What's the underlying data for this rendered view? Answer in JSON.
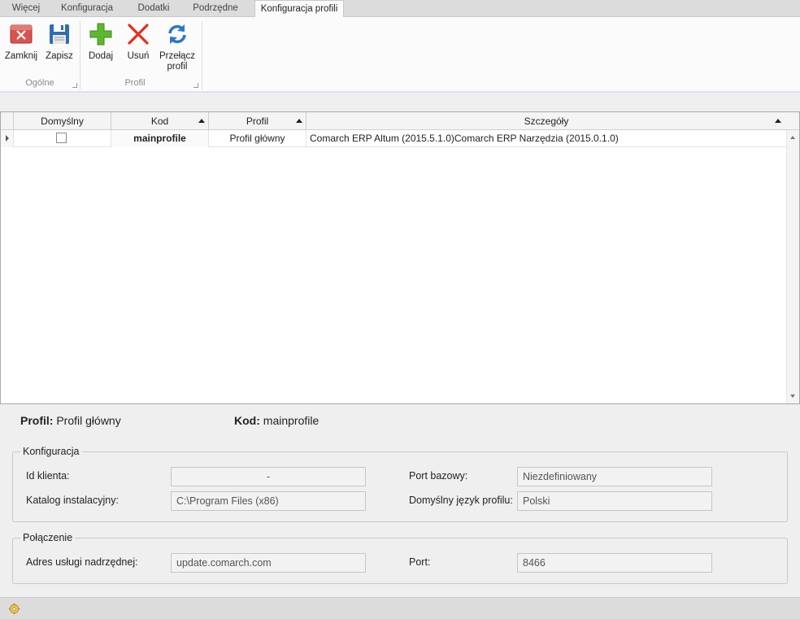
{
  "ribbon": {
    "tabs": [
      "Więcej",
      "Konfiguracja",
      "Dodatki",
      "Podrzędne",
      "Konfiguracja profili"
    ],
    "active_tab": "Konfiguracja profili",
    "groups": [
      {
        "label": "Ogólne",
        "buttons": [
          {
            "label": "Zamknij",
            "icon": "close-red-icon"
          },
          {
            "label": "Zapisz",
            "icon": "floppy-disk-icon"
          }
        ]
      },
      {
        "label": "Profil",
        "buttons": [
          {
            "label": "Dodaj",
            "icon": "plus-green-icon"
          },
          {
            "label": "Usuń",
            "icon": "delete-x-icon"
          },
          {
            "label": "Przełącz",
            "label2": "profil",
            "icon": "switch-refresh-icon"
          }
        ]
      }
    ]
  },
  "grid": {
    "columns": [
      "Domyślny",
      "Kod",
      "Profil",
      "Szczegóły"
    ],
    "rows": [
      {
        "default": false,
        "kod": "mainprofile",
        "profil": "Profil główny",
        "szczegoly": "Comarch ERP Altum (2015.5.1.0)Comarch ERP Narzędzia (2015.0.1.0)"
      }
    ]
  },
  "summary": {
    "profil_label": "Profil:",
    "profil_value": "Profil główny",
    "kod_label": "Kod:",
    "kod_value": "mainprofile"
  },
  "konfiguracja": {
    "title": "Konfiguracja",
    "id_klienta_label": "Id klienta:",
    "id_klienta_value": "-",
    "katalog_label": "Katalog instalacyjny:",
    "katalog_value": "C:\\Program Files (x86)",
    "port_bazowy_label": "Port bazowy:",
    "port_bazowy_value": "Niezdefiniowany",
    "jezyk_label": "Domyślny język profilu:",
    "jezyk_value": "Polski"
  },
  "polaczenie": {
    "title": "Połączenie",
    "adres_label": "Adres usługi nadrzędnej:",
    "adres_value": "update.comarch.com",
    "port_label": "Port:",
    "port_value": "8466"
  },
  "statusbar": {
    "icon": "settings-gear-icon"
  }
}
